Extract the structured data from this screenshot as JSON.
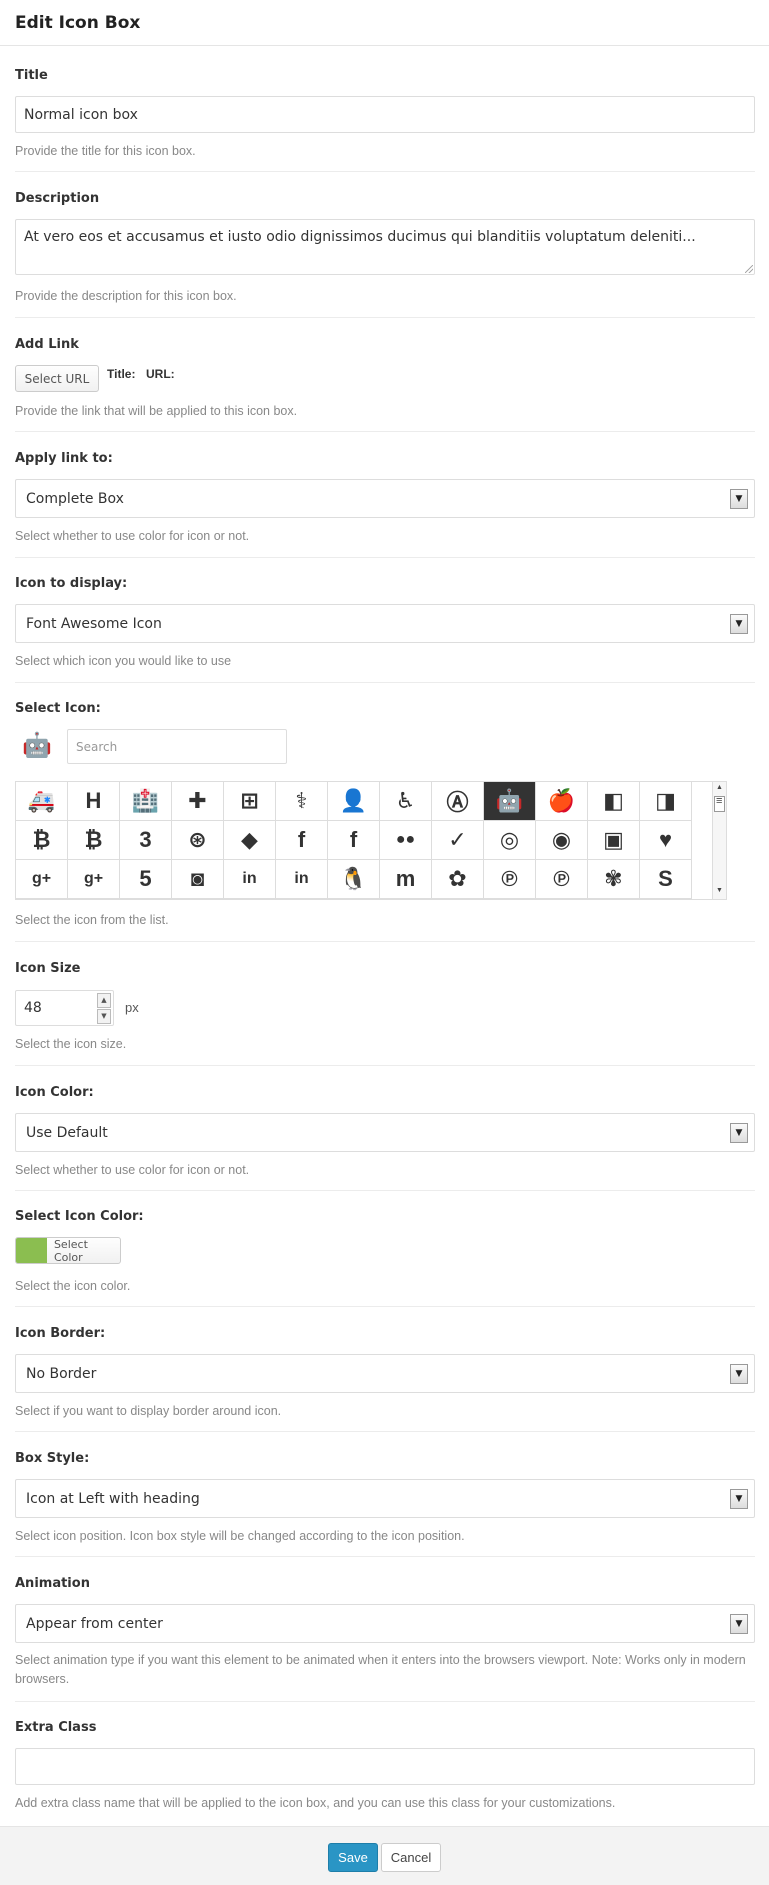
{
  "dialog": {
    "title": "Edit Icon Box"
  },
  "title_field": {
    "label": "Title",
    "value": "Normal icon box",
    "help": "Provide the title for this icon box."
  },
  "description_field": {
    "label": "Description",
    "value": "At vero eos et accusamus et iusto odio dignissimos ducimus qui blanditiis voluptatum deleniti...",
    "help": "Provide the description for this icon box."
  },
  "add_link": {
    "label": "Add Link",
    "button": "Select URL",
    "title_label": "Title:",
    "url_label": "URL:",
    "help": "Provide the link that will be applied to this icon box."
  },
  "apply_link": {
    "label": "Apply link to:",
    "value": "Complete Box",
    "help": "Select whether to use color for icon or not."
  },
  "icon_display": {
    "label": "Icon to display:",
    "value": "Font Awesome Icon",
    "help": "Select which icon you would like to use"
  },
  "select_icon": {
    "label": "Select Icon:",
    "preview_icon": "android-icon",
    "search_placeholder": "Search",
    "help": "Select the icon from the list.",
    "selected_index": 9,
    "icons": [
      {
        "name": "ambulance-icon",
        "glyph": "🚑"
      },
      {
        "name": "h-square-icon",
        "glyph": "H"
      },
      {
        "name": "hospital-icon",
        "glyph": "🏥"
      },
      {
        "name": "medkit-icon",
        "glyph": "✚"
      },
      {
        "name": "plus-square-icon",
        "glyph": "⊞"
      },
      {
        "name": "stethoscope-icon",
        "glyph": "⚕"
      },
      {
        "name": "user-md-icon",
        "glyph": "👤"
      },
      {
        "name": "wheelchair-icon",
        "glyph": "♿"
      },
      {
        "name": "adn-icon",
        "glyph": "Ⓐ"
      },
      {
        "name": "android-icon",
        "glyph": "🤖"
      },
      {
        "name": "apple-icon",
        "glyph": "🍎"
      },
      {
        "name": "bitbucket-icon",
        "glyph": "◧"
      },
      {
        "name": "bitbucket-square-icon",
        "glyph": "◨"
      },
      {
        "name": "bitcoin-icon",
        "glyph": "₿"
      },
      {
        "name": "btc-icon",
        "glyph": "₿"
      },
      {
        "name": "css3-icon",
        "glyph": "3"
      },
      {
        "name": "dribbble-icon",
        "glyph": "⊛"
      },
      {
        "name": "dropbox-icon",
        "glyph": "◆"
      },
      {
        "name": "facebook-icon",
        "glyph": "f"
      },
      {
        "name": "facebook-square-icon",
        "glyph": "f"
      },
      {
        "name": "flickr-icon",
        "glyph": "●●"
      },
      {
        "name": "foursquare-icon",
        "glyph": "✓"
      },
      {
        "name": "github-icon",
        "glyph": "◎"
      },
      {
        "name": "github-alt-icon",
        "glyph": "◉"
      },
      {
        "name": "github-square-icon",
        "glyph": "▣"
      },
      {
        "name": "gittip-icon",
        "glyph": "♥"
      },
      {
        "name": "google-plus-icon",
        "glyph": "g+"
      },
      {
        "name": "google-plus-square-icon",
        "glyph": "g+"
      },
      {
        "name": "html5-icon",
        "glyph": "5"
      },
      {
        "name": "instagram-icon",
        "glyph": "◙"
      },
      {
        "name": "linkedin-icon",
        "glyph": "in"
      },
      {
        "name": "linkedin-square-icon",
        "glyph": "in"
      },
      {
        "name": "linux-icon",
        "glyph": "🐧"
      },
      {
        "name": "maxcdn-icon",
        "glyph": "m"
      },
      {
        "name": "pagelines-icon",
        "glyph": "✿"
      },
      {
        "name": "pinterest-icon",
        "glyph": "℗"
      },
      {
        "name": "pinterest-square-icon",
        "glyph": "℗"
      },
      {
        "name": "renren-icon",
        "glyph": "✾"
      },
      {
        "name": "skype-icon",
        "glyph": "S"
      }
    ]
  },
  "icon_size": {
    "label": "Icon Size",
    "value": "48",
    "unit": "px",
    "help": "Select the icon size."
  },
  "icon_color": {
    "label": "Icon Color:",
    "value": "Use Default",
    "help": "Select whether to use color for icon or not."
  },
  "select_icon_color": {
    "label": "Select Icon Color:",
    "button": "Select Color",
    "swatch": "#8bbe50",
    "help": "Select the icon color."
  },
  "icon_border": {
    "label": "Icon Border:",
    "value": "No Border",
    "help": "Select if you want to display border around icon."
  },
  "box_style": {
    "label": "Box Style:",
    "value": "Icon at Left with heading",
    "help": "Select icon position. Icon box style will be changed according to the icon position."
  },
  "animation": {
    "label": "Animation",
    "value": "Appear from center",
    "help": "Select animation type if you want this element to be animated when it enters into the browsers viewport. Note: Works only in modern browsers."
  },
  "extra_class": {
    "label": "Extra Class",
    "value": "",
    "help": "Add extra class name that will be applied to the icon box, and you can use this class for your customizations."
  },
  "footer": {
    "save": "Save",
    "cancel": "Cancel",
    "accent": "#2a95c5"
  }
}
